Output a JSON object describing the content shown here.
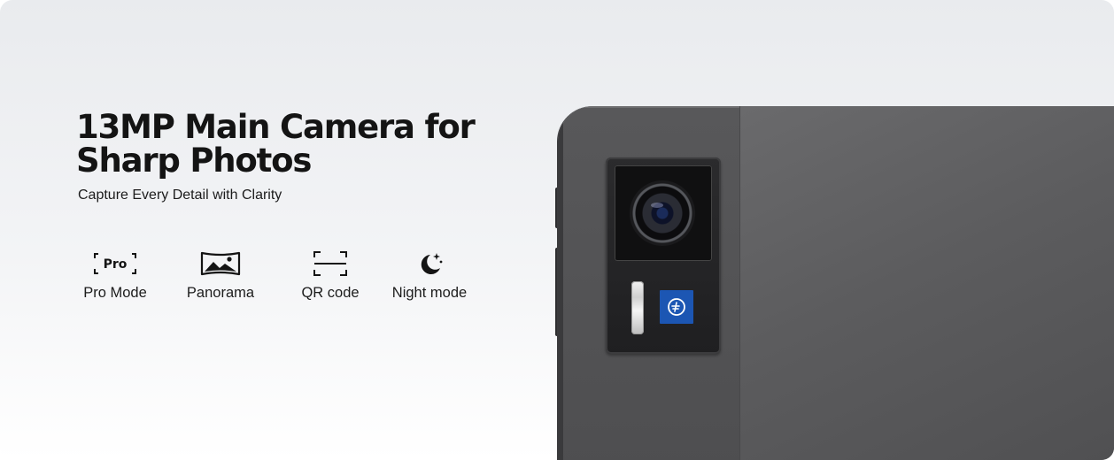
{
  "headline": {
    "title": "13MP Main Camera for\nSharp Photos",
    "subtitle": "Capture Every Detail with Clarity"
  },
  "features": [
    {
      "label": "Pro Mode",
      "icon": "pro-mode-icon",
      "icon_text": "Pro"
    },
    {
      "label": "Panorama",
      "icon": "panorama-icon"
    },
    {
      "label": "QR code",
      "icon": "qr-scan-icon"
    },
    {
      "label": "Night mode",
      "icon": "moon-stars-icon"
    }
  ],
  "colors": {
    "text": "#141414",
    "tablet_body": "#58585a",
    "camera_module": "#242426",
    "brand_badge": "#1c56b3"
  }
}
